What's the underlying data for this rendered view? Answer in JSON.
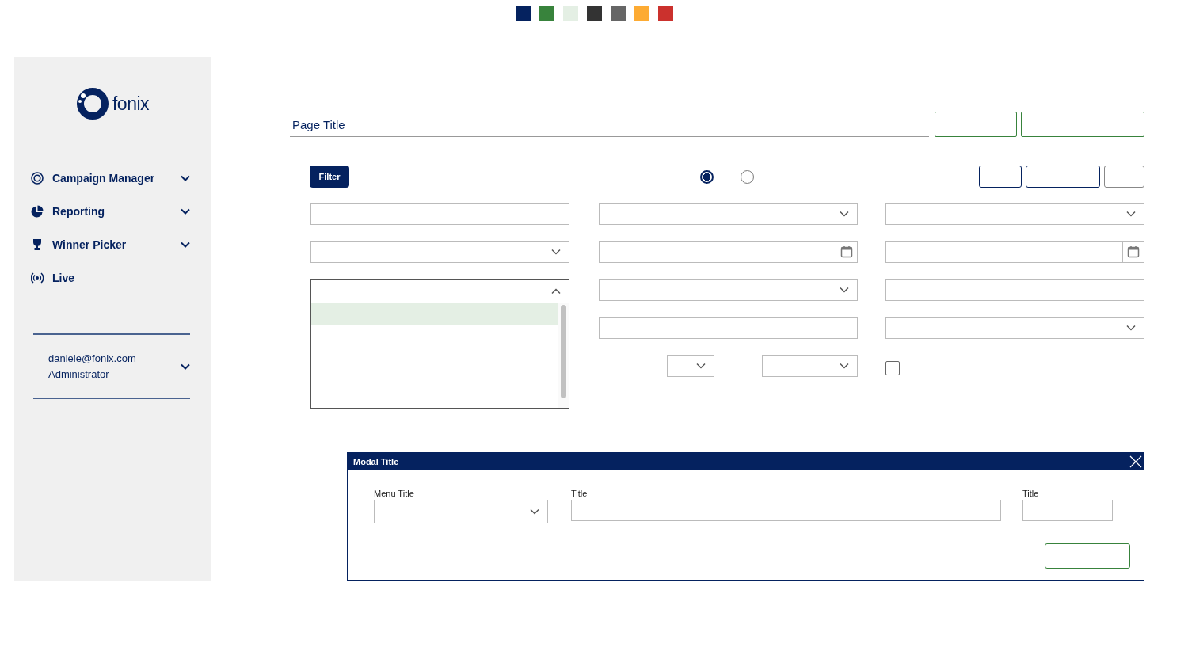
{
  "swatches": [
    {
      "color": "#05225f"
    },
    {
      "color": "#38833c"
    },
    {
      "color": "#e4efe4"
    },
    {
      "color": "#333333"
    },
    {
      "color": "#666666"
    },
    {
      "color": "#fdab33"
    },
    {
      "color": "#cb312d"
    }
  ],
  "sidebar": {
    "logo_text": "fonix",
    "items": [
      {
        "label": "Campaign Manager",
        "has_children": true
      },
      {
        "label": "Reporting",
        "has_children": true
      },
      {
        "label": "Winner Picker",
        "has_children": true
      },
      {
        "label": "Live",
        "has_children": false
      }
    ],
    "user": {
      "email": "daniele@fonix.com",
      "role": "Administrator"
    }
  },
  "page_title": "Page Title",
  "header_buttons": [
    {
      "kind": "wide"
    },
    {
      "kind": "wider"
    }
  ],
  "filter_button": "Filter",
  "radios": [
    {
      "selected": true
    },
    {
      "selected": false
    }
  ],
  "toolbar_buttons": [
    {
      "kind": "primary"
    },
    {
      "kind": "primary"
    },
    {
      "kind": "secondary"
    }
  ],
  "form_columns": [
    [
      {
        "kind": "text"
      },
      {
        "kind": "select"
      },
      {
        "kind": "listbox",
        "options": [
          {
            "selected": true
          },
          {
            "selected": false
          },
          {
            "selected": false
          },
          {
            "selected": false
          }
        ]
      }
    ],
    [
      {
        "kind": "select"
      },
      {
        "kind": "date"
      },
      {
        "kind": "select"
      },
      {
        "kind": "text"
      },
      {
        "kind": "select_pair"
      }
    ],
    [
      {
        "kind": "select"
      },
      {
        "kind": "date"
      },
      {
        "kind": "text"
      },
      {
        "kind": "select"
      },
      {
        "kind": "checkbox",
        "checked": false
      }
    ]
  ],
  "modal": {
    "title": "Modal Title",
    "fields": [
      {
        "label": "Menu Title",
        "kind": "select"
      },
      {
        "label": "Title",
        "kind": "text"
      },
      {
        "label": "Title",
        "kind": "short_text"
      }
    ],
    "buttons": [
      {
        "kind": "confirm"
      }
    ]
  }
}
